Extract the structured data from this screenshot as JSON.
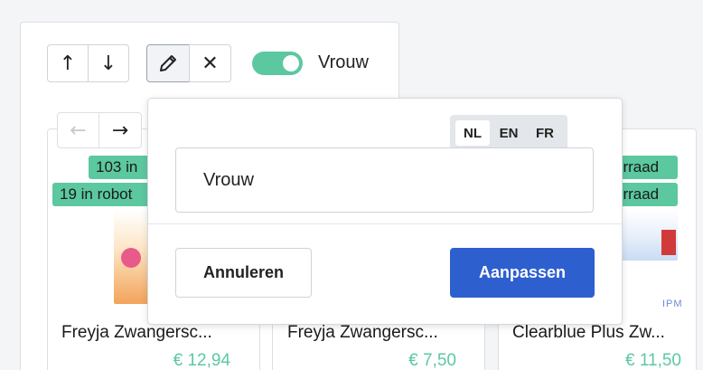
{
  "toolbar": {
    "up_icon": "arrow-up-icon",
    "up_glyph": "↑",
    "down_icon": "arrow-down-icon",
    "down_glyph": "↓",
    "edit_icon": "pencil-icon",
    "close_icon": "close-icon",
    "close_glyph": "✕",
    "toggle_on": true,
    "toggle_label": "Vrouw"
  },
  "carousel": {
    "prev_glyph": "←",
    "next_glyph": "→"
  },
  "products": [
    {
      "stock_badge": "103 in",
      "robot_badge": "19 in robot",
      "name": "Freyja Zwangersc...",
      "price": "€ 12,94"
    },
    {
      "name": "Freyja Zwangersc...",
      "price": "€ 7,50"
    },
    {
      "stock_badge": "orraad",
      "robot_badge": "orraad",
      "brand": "IPM",
      "name": "Clearblue Plus Zw...",
      "price": "€ 11,50"
    }
  ],
  "editor": {
    "languages": [
      "NL",
      "EN",
      "FR"
    ],
    "active_language": "NL",
    "value": "Vrouw",
    "cancel_label": "Annuleren",
    "apply_label": "Aanpassen"
  },
  "colors": {
    "accent_green": "#5cc8a0",
    "primary_blue": "#2e5fcf"
  }
}
